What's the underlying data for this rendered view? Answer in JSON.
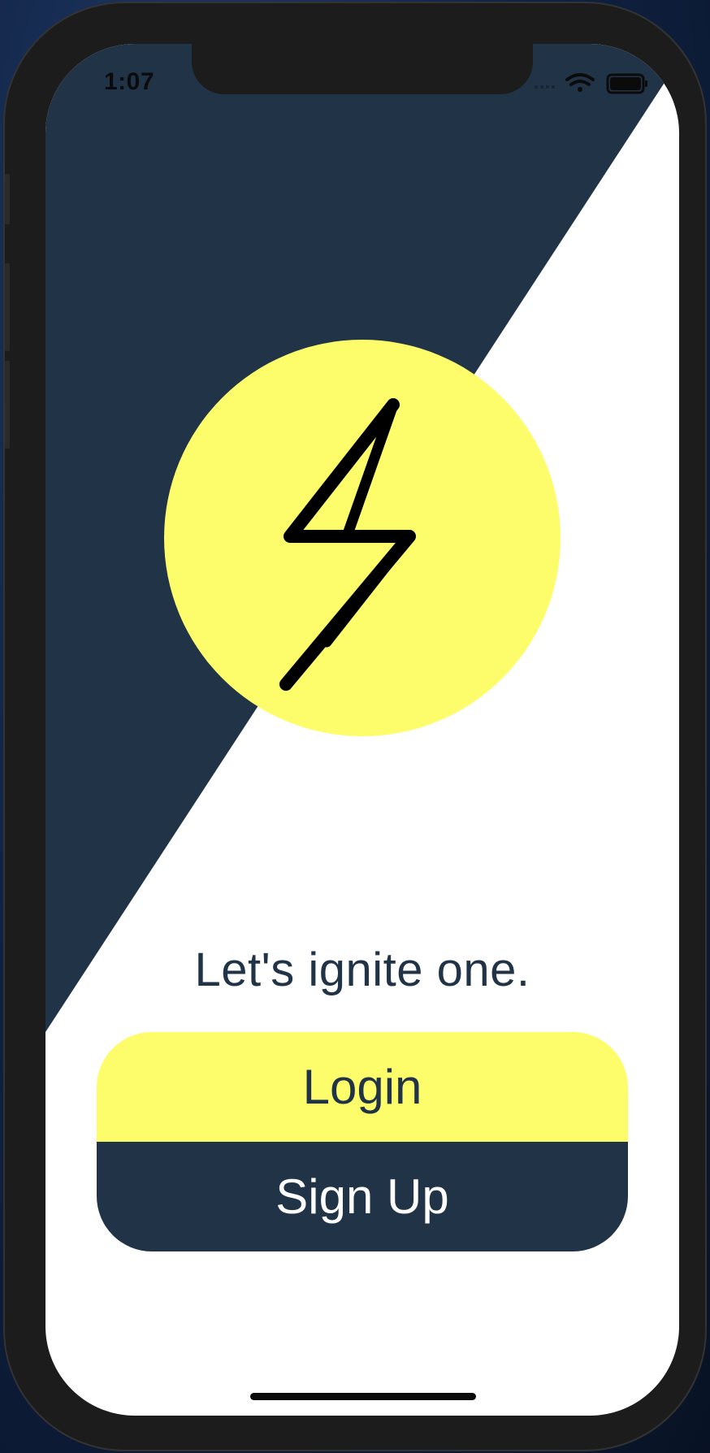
{
  "status_bar": {
    "time": "1:07",
    "icons": [
      "signal-icon",
      "wifi-icon",
      "battery-icon"
    ]
  },
  "logo": {
    "icon": "lightning-bolt-icon"
  },
  "tagline": "Let's ignite one.",
  "buttons": {
    "login_label": "Login",
    "signup_label": "Sign Up"
  },
  "colors": {
    "navy": "#203347",
    "yellow": "#fdfd6c",
    "white": "#ffffff"
  }
}
